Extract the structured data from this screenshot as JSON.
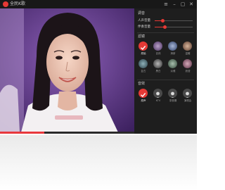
{
  "app": {
    "title": "全民K歌"
  },
  "titlebar": {
    "icons": [
      {
        "name": "menu-icon",
        "glyph": "≡"
      },
      {
        "name": "minimize-icon",
        "glyph": "–"
      },
      {
        "name": "restore-icon",
        "glyph": "▢"
      },
      {
        "name": "close-icon",
        "glyph": "✕"
      }
    ]
  },
  "video": {
    "progress_percent": 33
  },
  "panel": {
    "volume_section": {
      "title": "调音"
    },
    "sliders": [
      {
        "label": "人声音量",
        "value_percent": 22
      },
      {
        "label": "伴奏音量",
        "value_percent": 26
      }
    ],
    "filter_section": {
      "title": "滤镜",
      "items": [
        {
          "label": "原始",
          "selected": true
        },
        {
          "label": "自然",
          "selected": false
        },
        {
          "label": "清新",
          "selected": false
        },
        {
          "label": "温暖",
          "selected": false
        },
        {
          "label": "复古",
          "selected": false
        },
        {
          "label": "黑白",
          "selected": false
        },
        {
          "label": "淡雅",
          "selected": false
        },
        {
          "label": "浪漫",
          "selected": false
        }
      ]
    },
    "effect_section": {
      "title": "音效",
      "items": [
        {
          "label": "原声",
          "selected": true
        },
        {
          "label": "KTV",
          "selected": false
        },
        {
          "label": "录音棚",
          "selected": false
        },
        {
          "label": "演唱会",
          "selected": false
        }
      ]
    }
  },
  "colors": {
    "accent": "#e53935",
    "panel_bg": "#1e1e1e",
    "video_bg": "#6a3f93"
  }
}
